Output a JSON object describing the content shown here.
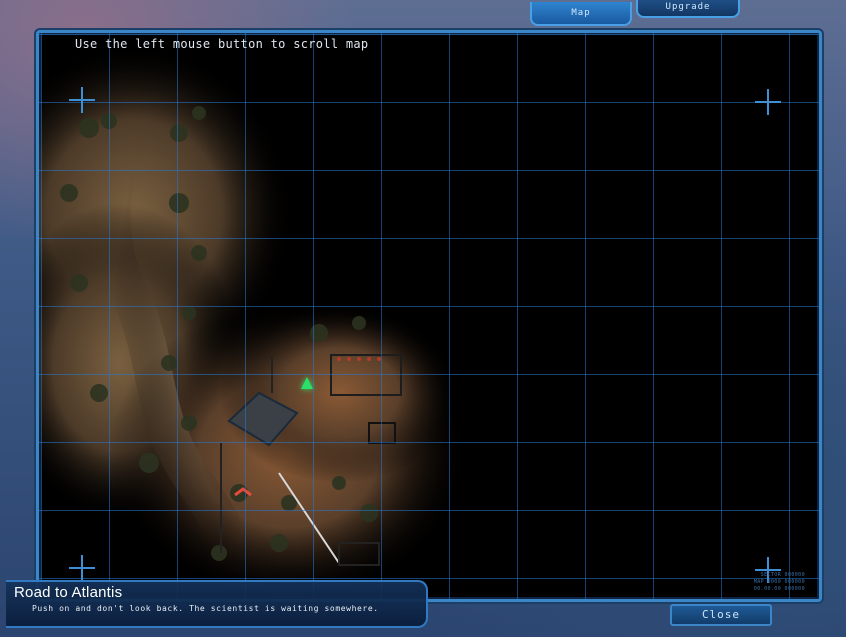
{
  "tabs": [
    {
      "label": "Map",
      "active": true
    },
    {
      "label": "Upgrade",
      "active": false
    }
  ],
  "map": {
    "hint": "Use the left mouse button to scroll map",
    "sector_readout": [
      "SECTOR 000000",
      "MAP 0000 000000",
      "00.00.00 000000"
    ]
  },
  "mission": {
    "title": "Road to Atlantis",
    "description": "Push on and don't look back. The scientist is waiting somewhere."
  },
  "buttons": {
    "close": "Close"
  },
  "colors": {
    "accent": "#3b86c9",
    "grid": "#2878d2",
    "player_marker": "#29e06a",
    "objective_marker": "#e84a3a"
  }
}
